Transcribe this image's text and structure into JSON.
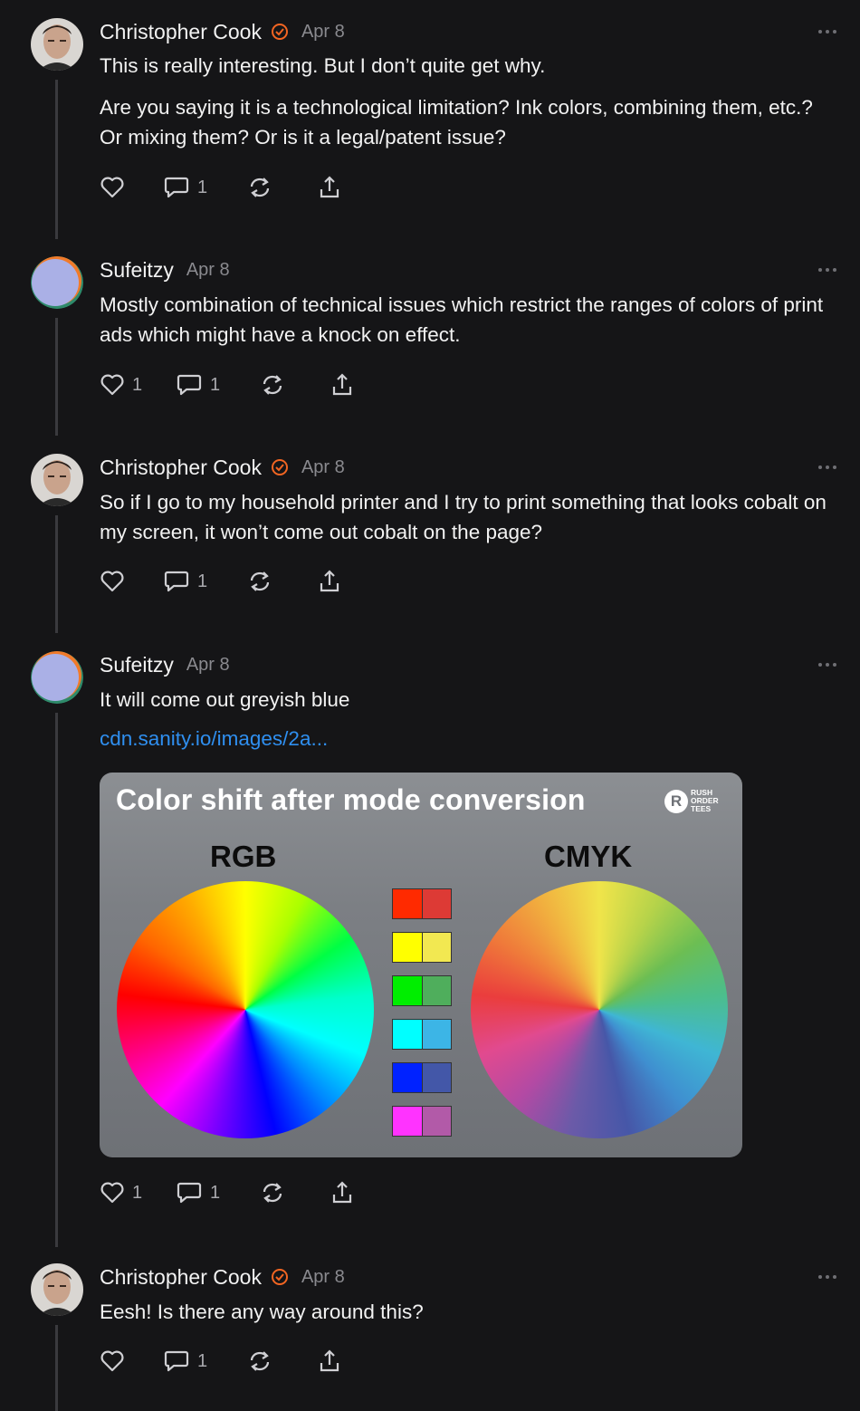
{
  "thread": [
    {
      "author": "Christopher Cook",
      "verified": true,
      "date": "Apr 8",
      "paragraphs": [
        "This is really interesting. But I don’t quite get why.",
        "Are you saying it is a technological limitation? Ink colors, combining them, etc.? Or mixing them? Or is it a legal/patent issue?"
      ],
      "likes": "",
      "replies": "1"
    },
    {
      "author": "Sufeitzy",
      "verified": false,
      "date": "Apr 8",
      "paragraphs": [
        "Mostly combination of technical issues which restrict the ranges of colors of print ads which might have a knock on effect."
      ],
      "likes": "1",
      "replies": "1"
    },
    {
      "author": "Christopher Cook",
      "verified": true,
      "date": "Apr 8",
      "paragraphs": [
        "So if I go to my household printer and I try to print something that looks cobalt on my screen, it won’t come out cobalt on the page?"
      ],
      "likes": "",
      "replies": "1"
    },
    {
      "author": "Sufeitzy",
      "verified": false,
      "date": "Apr 8",
      "paragraphs": [
        "It will come out greyish blue"
      ],
      "link": "cdn.sanity.io/images/2a...",
      "image": {
        "title": "Color shift after mode conversion",
        "left_label": "RGB",
        "right_label": "CMYK",
        "logo_text": [
          "RUSH",
          "ORDER",
          "TEES"
        ],
        "logo_mark": "R",
        "swatches": [
          {
            "rgb": "#ff2a00",
            "cmyk": "#dd3a35"
          },
          {
            "rgb": "#ffff00",
            "cmyk": "#f2e851"
          },
          {
            "rgb": "#00ee00",
            "cmyk": "#4fae5c"
          },
          {
            "rgb": "#00ffff",
            "cmyk": "#3cb5e6"
          },
          {
            "rgb": "#0022ff",
            "cmyk": "#4357a8"
          },
          {
            "rgb": "#ff33ff",
            "cmyk": "#b25aa8"
          }
        ]
      },
      "likes": "1",
      "replies": "1"
    },
    {
      "author": "Christopher Cook",
      "verified": true,
      "date": "Apr 8",
      "paragraphs": [
        "Eesh! Is there any way around this?"
      ],
      "likes": "",
      "replies": "1"
    }
  ],
  "colors": {
    "background": "#151517",
    "verified_badge": "#f26522",
    "link": "#2f8ff0",
    "muted": "#8a8a8f"
  }
}
